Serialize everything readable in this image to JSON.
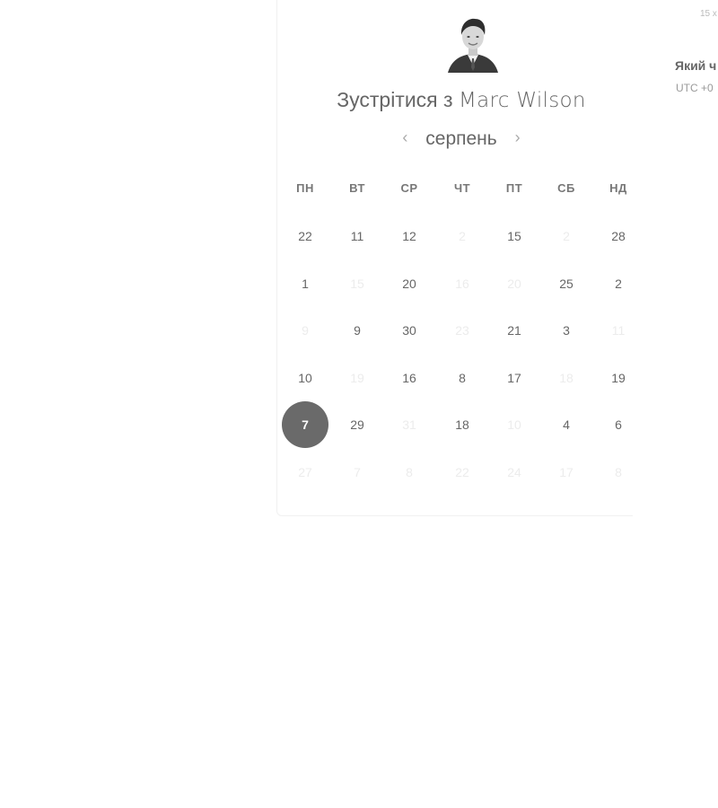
{
  "header": {
    "title_prefix": "Зустрітися з",
    "host_name": "Marc Wilson",
    "avatar_icon": "person-portrait-icon"
  },
  "calendar": {
    "month": "серпень",
    "prev_icon": "chevron-left-icon",
    "next_icon": "chevron-right-icon",
    "weekdays": [
      "ПН",
      "ВТ",
      "СР",
      "ЧТ",
      "ПТ",
      "СБ",
      "НД"
    ],
    "rows": [
      [
        {
          "label": "22",
          "available": true
        },
        {
          "label": "11",
          "available": true
        },
        {
          "label": "12",
          "available": true
        },
        {
          "label": "2",
          "available": false
        },
        {
          "label": "15",
          "available": true
        },
        {
          "label": "2",
          "available": false
        },
        {
          "label": "28",
          "available": true
        }
      ],
      [
        {
          "label": "1",
          "available": true
        },
        {
          "label": "15",
          "available": false
        },
        {
          "label": "20",
          "available": true
        },
        {
          "label": "16",
          "available": false
        },
        {
          "label": "20",
          "available": false
        },
        {
          "label": "25",
          "available": true
        },
        {
          "label": "2",
          "available": true
        }
      ],
      [
        {
          "label": "9",
          "available": false
        },
        {
          "label": "9",
          "available": true
        },
        {
          "label": "30",
          "available": true
        },
        {
          "label": "23",
          "available": false
        },
        {
          "label": "21",
          "available": true
        },
        {
          "label": "3",
          "available": true
        },
        {
          "label": "11",
          "available": false
        }
      ],
      [
        {
          "label": "10",
          "available": true
        },
        {
          "label": "19",
          "available": false
        },
        {
          "label": "16",
          "available": true
        },
        {
          "label": "8",
          "available": true
        },
        {
          "label": "17",
          "available": true
        },
        {
          "label": "18",
          "available": false
        },
        {
          "label": "19",
          "available": true
        }
      ],
      [
        {
          "label": "7",
          "available": true,
          "selected": true
        },
        {
          "label": "29",
          "available": true
        },
        {
          "label": "31",
          "available": false
        },
        {
          "label": "18",
          "available": true
        },
        {
          "label": "10",
          "available": false
        },
        {
          "label": "4",
          "available": true
        },
        {
          "label": "6",
          "available": true
        }
      ],
      [
        {
          "label": "27",
          "available": false
        },
        {
          "label": "7",
          "available": false
        },
        {
          "label": "8",
          "available": false
        },
        {
          "label": "22",
          "available": false
        },
        {
          "label": "24",
          "available": false
        },
        {
          "label": "17",
          "available": false
        },
        {
          "label": "8",
          "available": false
        }
      ]
    ]
  },
  "side_panel": {
    "duration": "15 x",
    "timezone_question": "Який ч",
    "timezone_value": "UTC +0"
  },
  "colors": {
    "selected_day": "#6a6a6a",
    "text": "#666666",
    "disabled_text": "#ececec"
  }
}
